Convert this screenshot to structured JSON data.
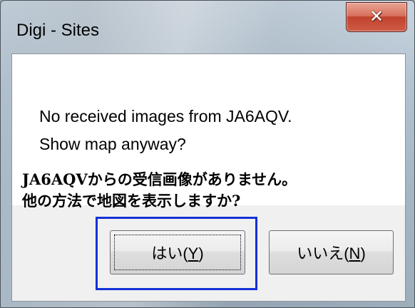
{
  "window": {
    "title": "Digi - Sites",
    "close_icon": "close-icon"
  },
  "message": {
    "line1": "No received images from JA6AQV.",
    "line2": "Show map anyway?",
    "jp_line1": "JA6AQVからの受信画像がありません。",
    "jp_line2": "他の方法で地図を表示しますか?"
  },
  "buttons": {
    "yes_prefix": "はい(",
    "yes_mnemonic": "Y",
    "yes_suffix": ")",
    "no_prefix": "いいえ(",
    "no_mnemonic": "N",
    "no_suffix": ")"
  },
  "colors": {
    "highlight_border": "#1230d8",
    "close_button": "#c0422c"
  }
}
